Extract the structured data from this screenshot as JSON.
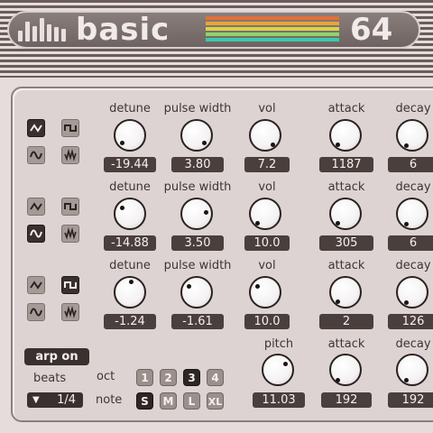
{
  "header": {
    "title": "basic",
    "number": "64",
    "rainbow_colors": [
      "#e2703a",
      "#e8a53b",
      "#d9d34a",
      "#8fd46c",
      "#3ccba8"
    ]
  },
  "rows": [
    {
      "waves": [
        {
          "icon": "triangle-wave-icon",
          "selected": true
        },
        {
          "icon": "square-wave-icon",
          "selected": false
        },
        {
          "icon": "sine-wave-icon",
          "selected": false
        },
        {
          "icon": "noise-wave-icon",
          "selected": false
        }
      ],
      "labels": [
        "detune",
        "pulse width",
        "vol",
        "attack",
        "decay"
      ],
      "values": [
        "-19.44",
        "3.80",
        "7.2",
        "1187",
        "6"
      ]
    },
    {
      "waves": [
        {
          "icon": "triangle-wave-icon",
          "selected": false
        },
        {
          "icon": "square-wave-icon",
          "selected": false
        },
        {
          "icon": "sine-wave-icon",
          "selected": true
        },
        {
          "icon": "noise-wave-icon",
          "selected": false
        }
      ],
      "labels": [
        "detune",
        "pulse width",
        "vol",
        "attack",
        "decay"
      ],
      "values": [
        "-14.88",
        "3.50",
        "10.0",
        "305",
        "6"
      ]
    },
    {
      "waves": [
        {
          "icon": "triangle-wave-icon",
          "selected": false
        },
        {
          "icon": "square-wave-icon",
          "selected": true
        },
        {
          "icon": "sine-wave-icon",
          "selected": false
        },
        {
          "icon": "noise-wave-icon",
          "selected": false
        }
      ],
      "labels": [
        "detune",
        "pulse width",
        "vol",
        "attack",
        "decay"
      ],
      "values": [
        "-1.24",
        "-1.61",
        "10.0",
        "2",
        "126"
      ]
    }
  ],
  "arp": {
    "button_label": "arp on",
    "beats_label": "beats",
    "beats_value": "1/4",
    "oct_label": "oct",
    "oct_options": [
      "1",
      "2",
      "3",
      "4"
    ],
    "oct_selected": "3",
    "note_label": "note",
    "note_options": [
      "S",
      "M",
      "L",
      "XL"
    ],
    "note_selected": "S",
    "labels": [
      "pitch",
      "attack",
      "decay"
    ],
    "values": [
      "11.03",
      "192",
      "192"
    ]
  }
}
